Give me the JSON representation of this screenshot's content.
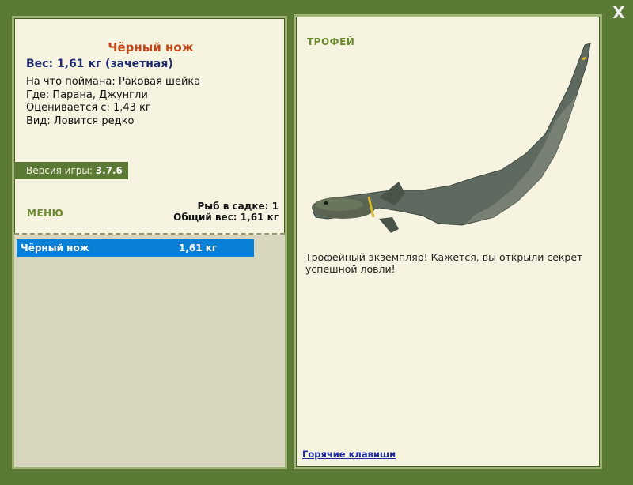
{
  "window": {
    "close_label": "X"
  },
  "fish": {
    "title": "Чёрный нож",
    "weight": "Вес: 1,61 кг (зачетная)",
    "info": [
      "На что поймана: Раковая шейка",
      "Где: Парана, Джунгли",
      "Оценивается с: 1,43 кг",
      "Вид: Ловится редко"
    ]
  },
  "version": {
    "label": "Версия игры:",
    "value": "3.7.6"
  },
  "menu": {
    "label": "МЕНЮ"
  },
  "totals": {
    "fish_count": "Рыб в садке: 1",
    "total_weight": "Общий вес: 1,61 кг"
  },
  "catch_list": [
    {
      "name": "Чёрный нож",
      "weight": "1,61 кг"
    }
  ],
  "trophy": {
    "label": "ТРОФЕЙ",
    "text": "Трофейный экземпляр! Кажется, вы открыли секрет успешной ловли!"
  },
  "hotkeys": {
    "label": "Горячие клавиши"
  },
  "colors": {
    "frame": "#5b7a35",
    "panel": "#f6f3e0",
    "selection": "#0a7fd6",
    "title": "#c0481a",
    "accent": "#6a8a2e"
  }
}
